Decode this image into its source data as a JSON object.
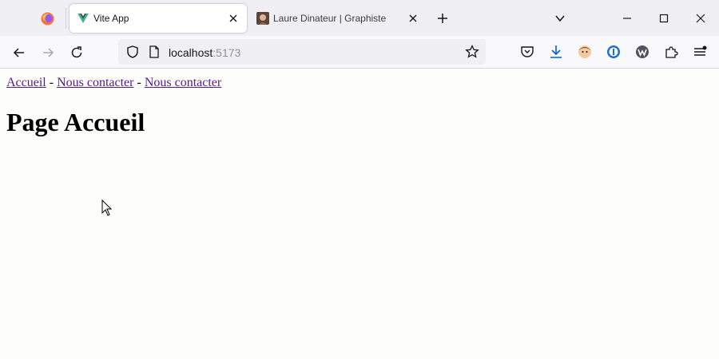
{
  "browser": {
    "tabs": [
      {
        "title": "Vite App",
        "active": true,
        "favicon": "vue-logo-icon"
      },
      {
        "title": "Laure Dinateur | Graphiste",
        "active": false,
        "favicon": "portrait-favicon-icon"
      }
    ],
    "url": {
      "host": "localhost",
      "port": ":5173"
    }
  },
  "page": {
    "nav": {
      "link_home": "Accueil",
      "separator_1": " - ",
      "link_contact_1": "Nous contacter",
      "separator_2": " - ",
      "link_contact_2": "Nous contacter"
    },
    "heading": "Page Accueil"
  },
  "colors": {
    "tabstrip_bg": "#f0f0f4",
    "navbar_bg": "#f9f9fb",
    "page_bg": "#fdfdfb",
    "visited_link": "#551a8b",
    "download_accent": "#0061e0"
  }
}
